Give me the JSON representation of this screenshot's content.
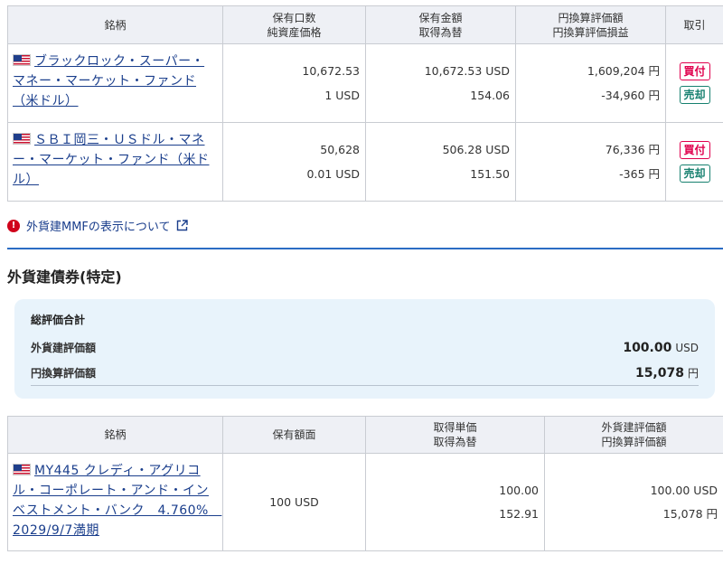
{
  "mmf_table": {
    "headers": {
      "name": "銘柄",
      "col2_line1": "保有口数",
      "col2_line2": "純資産価格",
      "col3_line1": "保有金額",
      "col3_line2": "取得為替",
      "col4_line1": "円換算評価額",
      "col4_line2": "円換算評価損益",
      "trade": "取引"
    },
    "rows": [
      {
        "name": "ブラックロック・スーパー・マネー・マーケット・ファンド（米ドル）",
        "units": "10,672.53",
        "nav": "1 USD",
        "holding_amount": "10,672.53 USD",
        "fx_rate": "154.06",
        "jpy_value": "1,609,204 円",
        "jpy_pl": "-34,960 円",
        "buy_label": "買付",
        "sell_label": "売却"
      },
      {
        "name": "ＳＢＩ岡三・ＵＳドル・マネー・マーケット・ファンド（米ドル）",
        "units": "50,628",
        "nav": "0.01 USD",
        "holding_amount": "506.28 USD",
        "fx_rate": "151.50",
        "jpy_value": "76,336 円",
        "jpy_pl": "-365 円",
        "buy_label": "買付",
        "sell_label": "売却"
      }
    ]
  },
  "notice": {
    "text": "外貨建MMFの表示について"
  },
  "section": {
    "title": "外貨建債券(特定)"
  },
  "summary": {
    "title": "総評価合計",
    "foreign_label": "外貨建評価額",
    "foreign_value": "100.00",
    "foreign_unit": "USD",
    "jpy_label": "円換算評価額",
    "jpy_value": "15,078",
    "jpy_unit": "円"
  },
  "bond_table": {
    "headers": {
      "name": "銘柄",
      "face": "保有額面",
      "col3_line1": "取得単価",
      "col3_line2": "取得為替",
      "col4_line1": "外貨建評価額",
      "col4_line2": "円換算評価額"
    },
    "rows": [
      {
        "name": "MY445 クレディ・アグリコル・コーポレート・アンド・インベストメント・バンク　4.760%　2029/9/7満期",
        "face_amount": "100 USD",
        "unit_price": "100.00",
        "fx_rate": "152.91",
        "foreign_value": "100.00 USD",
        "jpy_value": "15,078 円"
      }
    ]
  },
  "colors": {
    "link": "#1a3e8c",
    "buy": "#e0004d",
    "sell": "#16806f",
    "accent_divider": "#2b6cc4",
    "summary_bg": "#e8f3fb",
    "header_bg": "#eef0f5"
  },
  "icons": {
    "flag": "us-flag-icon",
    "alert": "alert-icon",
    "external": "external-link-icon"
  }
}
